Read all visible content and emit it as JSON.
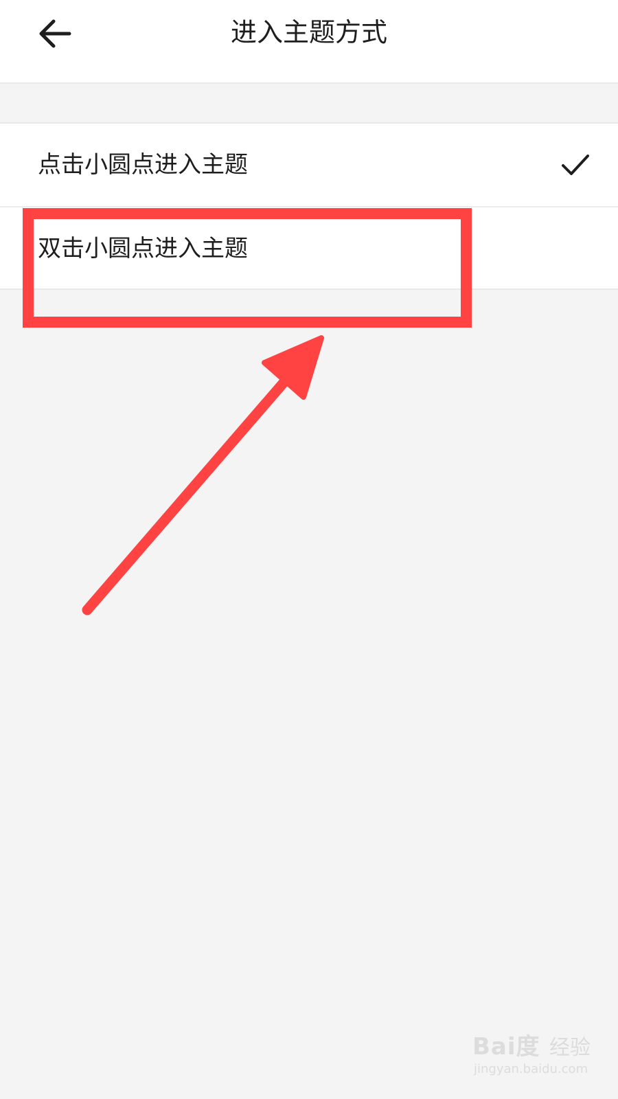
{
  "header": {
    "title": "进入主题方式",
    "back_icon": "arrow-left-icon"
  },
  "options": [
    {
      "label": "点击小圆点进入主题",
      "selected": true,
      "check_icon": "checkmark-icon"
    },
    {
      "label": "双击小圆点进入主题",
      "selected": false
    }
  ],
  "annotation": {
    "color": "#ff4242",
    "highlight_target": "option-double-click",
    "arrow_icon": "arrow-pointer-icon"
  },
  "watermark": {
    "brand": "Bai度",
    "cn": "经验",
    "url": "jingyan.baidu.com"
  },
  "colors": {
    "background": "#f4f4f4",
    "surface": "#ffffff",
    "text": "#1e1e1e",
    "annotation": "#ff4242"
  }
}
